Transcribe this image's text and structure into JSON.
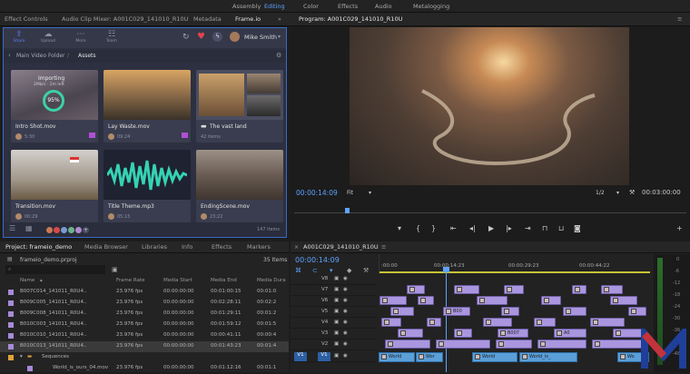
{
  "workspaces": [
    "Assembly",
    "Editing",
    "Color",
    "Effects",
    "Audio",
    "Metalogging"
  ],
  "active_workspace": "Editing",
  "tabs": [
    "Effect Controls",
    "Audio Clip Mixer: A001C029_141010_R10U",
    "Metadata",
    "Frame.io"
  ],
  "program_title": "Program: A001C029_141010_R10U",
  "frameio": {
    "tools": [
      {
        "label": "Share",
        "icon": "share-icon"
      },
      {
        "label": "Upload",
        "icon": "upload-icon"
      },
      {
        "label": "More",
        "icon": "more-icon"
      },
      {
        "label": "Team",
        "icon": "team-icon"
      }
    ],
    "user": "Mike Smith",
    "breadcrumb": "Main Video Folder",
    "section": "Assets",
    "cards": [
      {
        "name": "Intro Shot.mov",
        "meta": "5:30",
        "status": "Importing",
        "status_detail": "2Mb/s · 2m left",
        "percent": "95%"
      },
      {
        "name": "Lay Waste.mov",
        "meta": "09:24"
      },
      {
        "name": "The vast land",
        "meta": "42 items"
      },
      {
        "name": "Transition.mov",
        "meta": "00:29"
      },
      {
        "name": "Title Theme.mp3",
        "meta": "05:15"
      },
      {
        "name": "EndingScene.mov",
        "meta": "23:22"
      }
    ],
    "item_count": "147 items"
  },
  "program": {
    "timecode": "00:00:14:09",
    "fit": "Fit",
    "scale": "1/2",
    "duration": "00:03:00:00"
  },
  "project": {
    "tabs": [
      "Project: frameio_demo",
      "Media Browser",
      "Libraries",
      "Info",
      "Effects",
      "Markers"
    ],
    "file": "frameio_demo.prproj",
    "count": "35 Items",
    "columns": [
      "Name",
      "Frame Rate",
      "Media Start",
      "Media End",
      "Media Dura"
    ],
    "rows": [
      [
        "B007C014_141011_R0U4..",
        "23.976 fps",
        "00:00:00:00",
        "00:01:00:15",
        "00:01:0"
      ],
      [
        "B009C005_141011_R0U4..",
        "23.976 fps",
        "00:00:00:00",
        "00:02:28:11",
        "00:02:2"
      ],
      [
        "B009C008_141011_R0U4..",
        "23.976 fps",
        "00:00:00:00",
        "00:01:29:11",
        "00:01:2"
      ],
      [
        "B010C003_141011_R0U4..",
        "23.976 fps",
        "00:00:00:00",
        "00:01:59:12",
        "00:01:5"
      ],
      [
        "B010C010_141011_R0U4..",
        "23.976 fps",
        "00:00:00:00",
        "00:00:41:11",
        "00:00:4"
      ],
      [
        "B010C013_141011_R0U4..",
        "23.976 fps",
        "00:00:00:00",
        "00:01:43:23",
        "00:01:4"
      ]
    ],
    "folder": "Sequences",
    "last_row": [
      "World_is_ours_04.mov",
      "23.976 fps",
      "00:00:00:00",
      "00:01:12:16",
      "00:01:1"
    ]
  },
  "timeline": {
    "title": "A001C029_141010_R10U",
    "timecode": "00:00:14:09",
    "ruler": [
      ":00:00",
      "00:00:14:23",
      "00:00:29:23",
      "00:00:44:22"
    ],
    "tracks": [
      "V8",
      "V7",
      "V6",
      "V5",
      "V4",
      "V3",
      "V2",
      "V1"
    ],
    "src": "V1",
    "clip_labels": [
      "B00",
      "B007",
      "A0",
      "World",
      "Wor",
      "World_is_",
      "Wo"
    ],
    "db": [
      "0",
      "-6",
      "-12",
      "-18",
      "-24",
      "-30",
      "-36",
      "-42",
      "-48"
    ]
  },
  "colors": {
    "accent": "#5ea3ff",
    "frameio_border": "#3a69c4",
    "clip_video": "#a996de",
    "clip_audio": "#5a9fd8",
    "playhead": "#5ea3ff"
  }
}
